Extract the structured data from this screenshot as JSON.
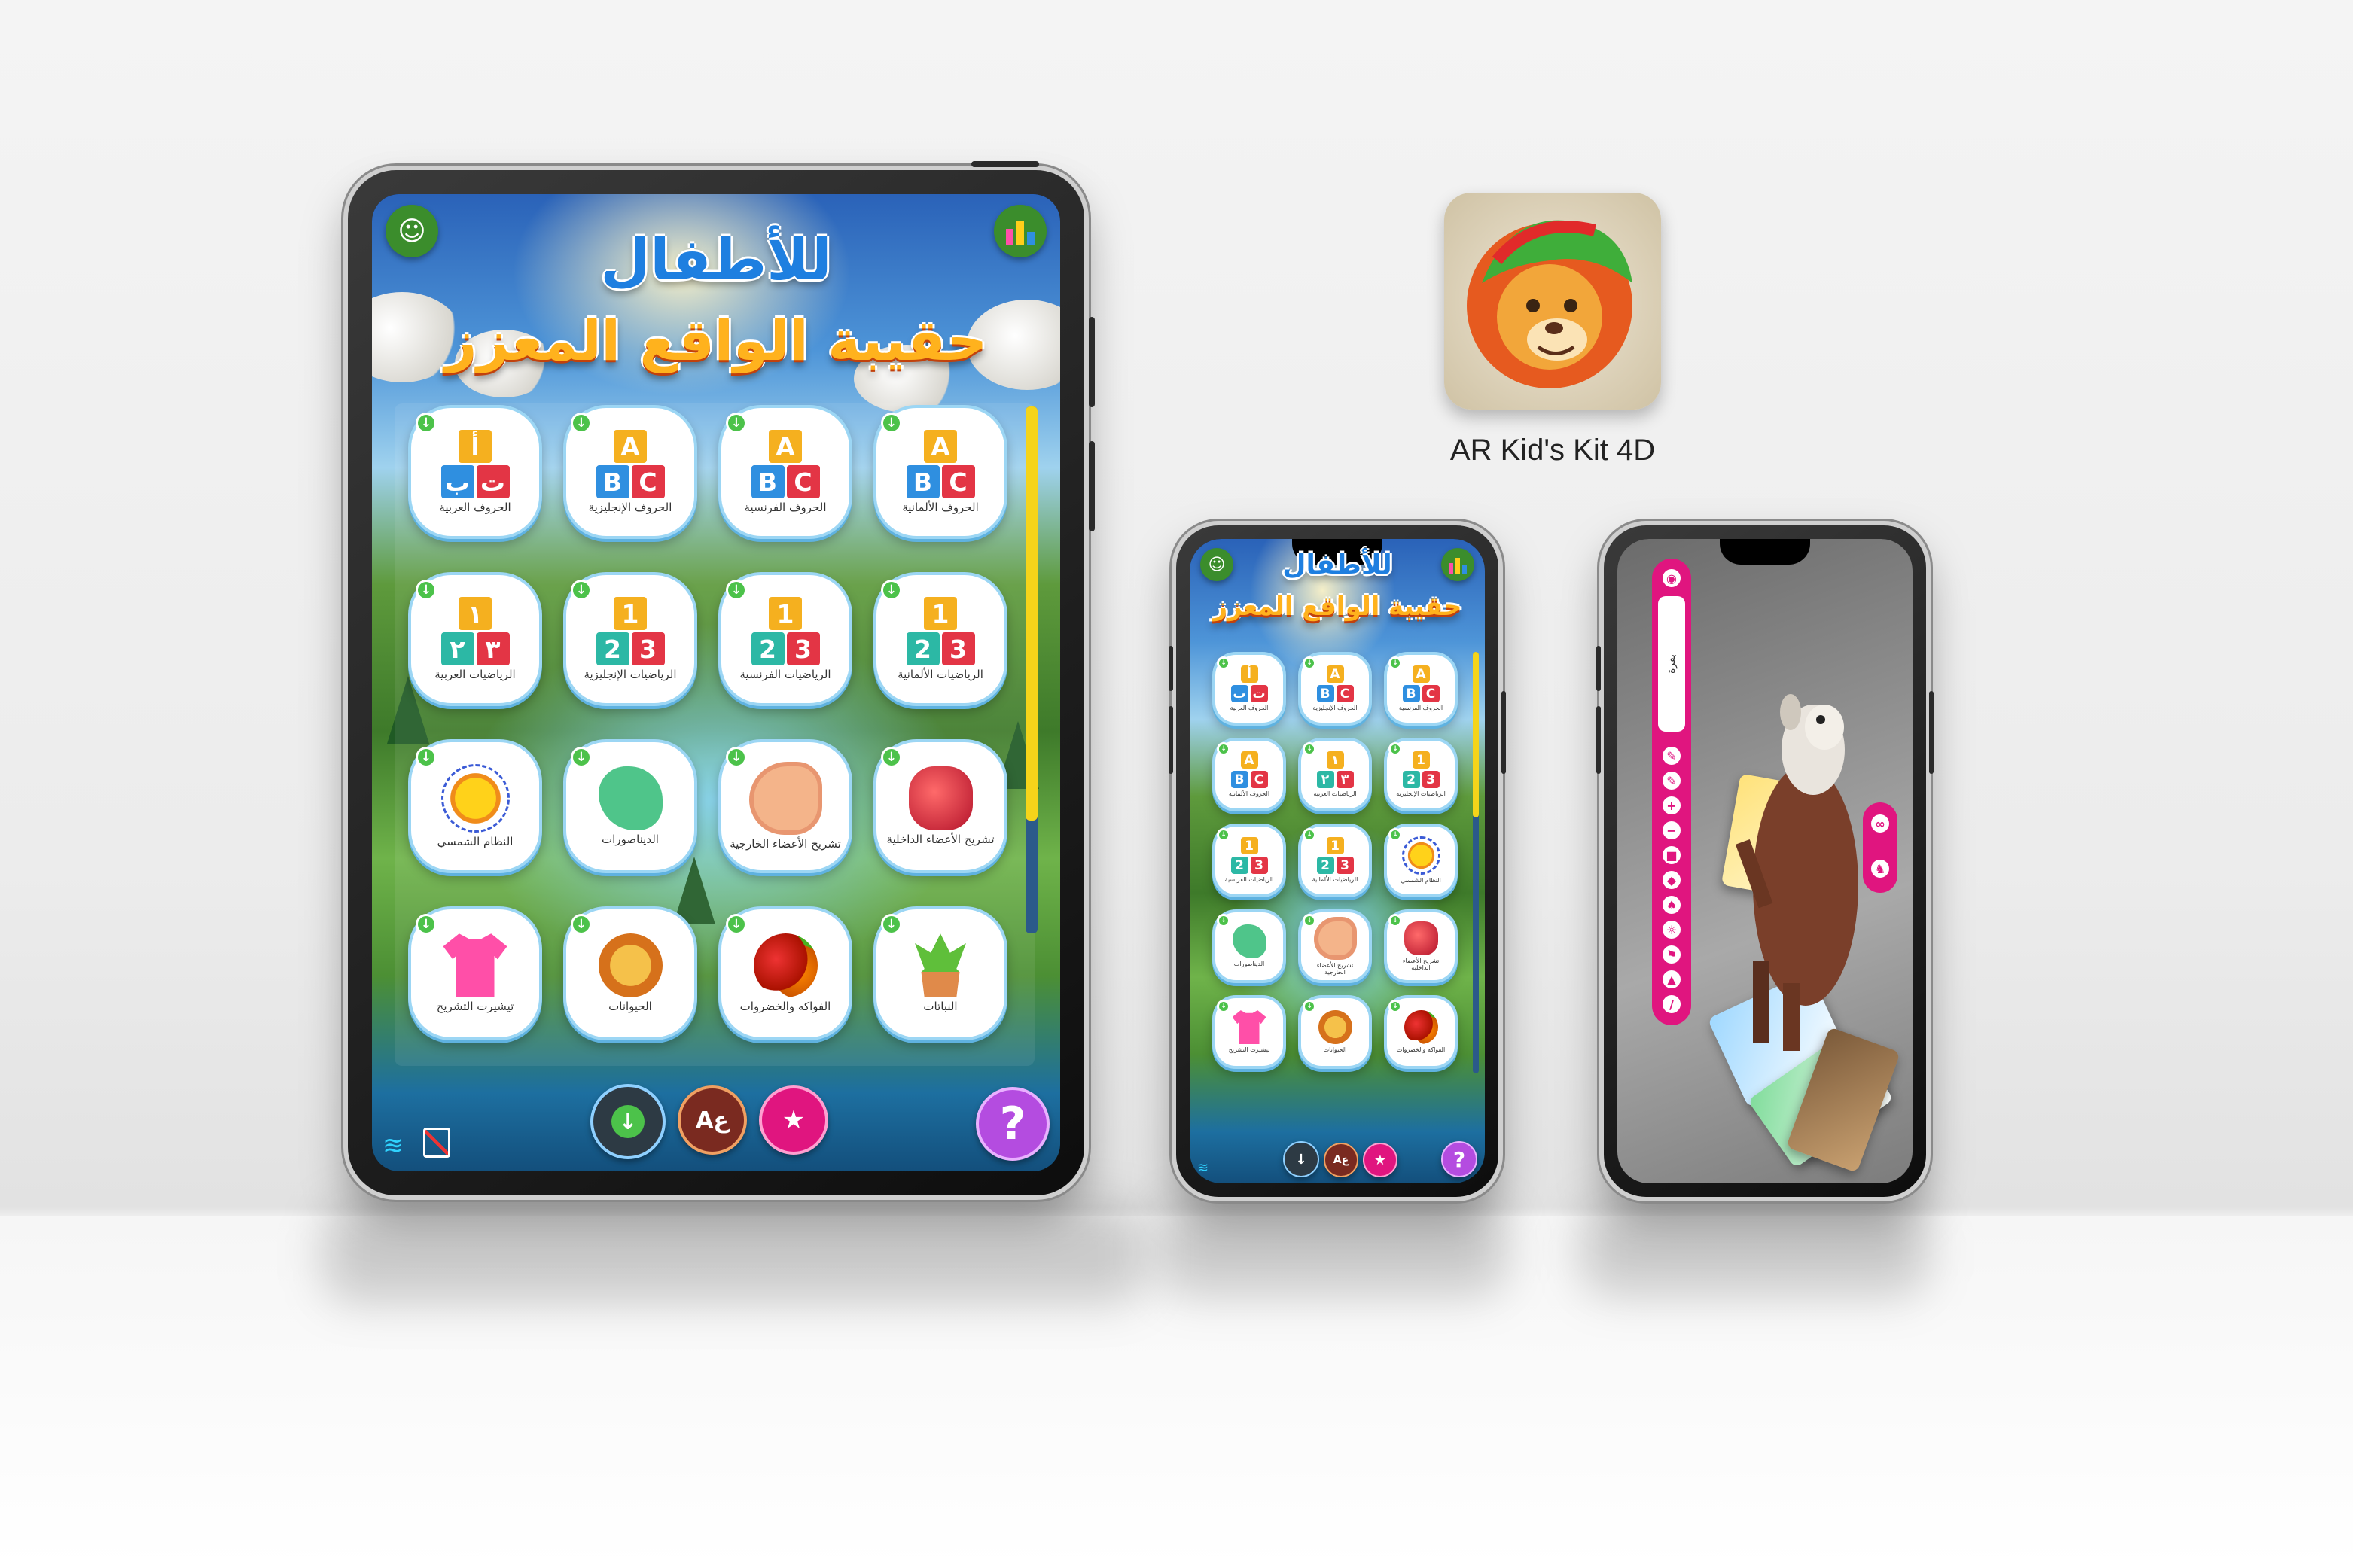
{
  "app": {
    "name": "AR Kid's Kit 4D",
    "title_line1": "للأطفال",
    "title_line2": "حقيبة الواقع المعزز"
  },
  "tiles": [
    {
      "label": "الحروف العربية",
      "icon": "arabic-letters",
      "glyphs": [
        "أ",
        "ب",
        "ت"
      ]
    },
    {
      "label": "الحروف الإنجليزية",
      "icon": "english-letters",
      "glyphs": [
        "A",
        "B",
        "C"
      ]
    },
    {
      "label": "الحروف الفرنسية",
      "icon": "french-letters",
      "glyphs": [
        "A",
        "B",
        "C"
      ]
    },
    {
      "label": "الحروف الألمانية",
      "icon": "german-letters",
      "glyphs": [
        "A",
        "B",
        "C"
      ]
    },
    {
      "label": "الرياضيات العربية",
      "icon": "arabic-math",
      "glyphs": [
        "١",
        "٢",
        "٣"
      ]
    },
    {
      "label": "الرياضيات الإنجليزية",
      "icon": "english-math",
      "glyphs": [
        "1",
        "2",
        "3"
      ]
    },
    {
      "label": "الرياضيات الفرنسية",
      "icon": "french-math",
      "glyphs": [
        "1",
        "2",
        "3"
      ]
    },
    {
      "label": "الرياضيات الألمانية",
      "icon": "german-math",
      "glyphs": [
        "1",
        "2",
        "3"
      ]
    },
    {
      "label": "النظام الشمسي",
      "icon": "solar-system"
    },
    {
      "label": "الديناصورات",
      "icon": "dinosaur"
    },
    {
      "label": "تشريح الأعضاء الخارجية",
      "icon": "ear"
    },
    {
      "label": "تشريح الأعضاء الداخلية",
      "icon": "heart"
    },
    {
      "label": "تيشيرت التشريح",
      "icon": "qr-shirt"
    },
    {
      "label": "الحيوانات",
      "icon": "lion"
    },
    {
      "label": "الفواكه والخضروات",
      "icon": "fruits"
    },
    {
      "label": "النباتات",
      "icon": "plant"
    }
  ],
  "bottom_bar": {
    "help": "?",
    "download": "↓",
    "language": "Aع",
    "cards": "★"
  },
  "ar_view": {
    "side_label": "بقرة",
    "tools": [
      "eye",
      "ruler",
      "pencil",
      "plus",
      "minus",
      "square",
      "eraser",
      "paint",
      "dance",
      "run",
      "shark",
      "wand"
    ]
  },
  "download_badge": "↓",
  "colors": {
    "accent_pink": "#e0157f",
    "tile_border": "#9cd6f4",
    "title_orange": "#ffb21d",
    "title_blue": "#1e7fe0"
  }
}
